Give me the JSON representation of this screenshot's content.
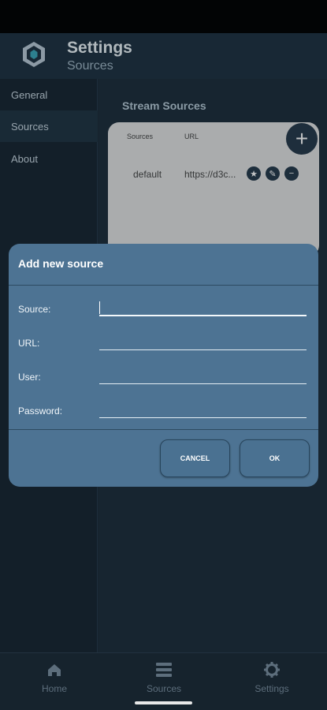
{
  "app": {
    "title": "Settings",
    "subtitle": "Sources"
  },
  "sidebar": {
    "items": [
      {
        "label": "General"
      },
      {
        "label": "Sources"
      },
      {
        "label": "About"
      }
    ]
  },
  "content": {
    "title": "Stream Sources",
    "table": {
      "headers": [
        "Sources",
        "URL"
      ],
      "rows": [
        {
          "source": "default",
          "url": "https://d3c..."
        }
      ]
    },
    "add_icon": "plus-icon",
    "row_icons": [
      "star-icon",
      "edit-pencil-icon",
      "remove-minus-icon"
    ]
  },
  "dialog": {
    "title": "Add new source",
    "fields": [
      {
        "label": "Source:",
        "value": ""
      },
      {
        "label": "URL:",
        "value": ""
      },
      {
        "label": "User:",
        "value": ""
      },
      {
        "label": "Password:",
        "value": ""
      }
    ],
    "cancel_label": "CANCEL",
    "ok_label": "OK"
  },
  "bottom_nav": {
    "items": [
      {
        "label": "Home",
        "icon": "home-icon"
      },
      {
        "label": "Sources",
        "icon": "list-icon"
      },
      {
        "label": "Settings",
        "icon": "gear-icon"
      }
    ]
  },
  "colors": {
    "dialog": "#4d7393",
    "appbar": "#1e3140",
    "background": "#1b2a36"
  }
}
